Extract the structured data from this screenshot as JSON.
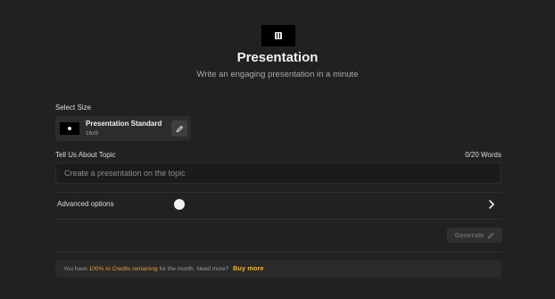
{
  "header": {
    "title": "Presentation",
    "subtitle": "Write an engaging presentation in a minute",
    "thumbnail_icon": "presentation-icon"
  },
  "size_section": {
    "label": "Select Size",
    "card": {
      "name": "Presentation Standard",
      "ratio": "16x9",
      "edit_icon": "pencil-icon"
    }
  },
  "topic_section": {
    "label": "Tell Us About Topic",
    "word_count": "0/20 Words",
    "input_value": "",
    "input_placeholder": "Create a presentation on the topic"
  },
  "advanced": {
    "label": "Advanced options",
    "toggle_on": false,
    "expand_icon": "chevron-right-icon"
  },
  "generate": {
    "label": "Generate",
    "icon": "pencil-icon",
    "disabled": true
  },
  "credits": {
    "prefix": "You have",
    "highlight": "100% AI Credits remaining",
    "suffix": "for the month. Need more?",
    "buy_label": "Buy more"
  },
  "colors": {
    "background": "#212121",
    "accent": "#f5b32a"
  }
}
